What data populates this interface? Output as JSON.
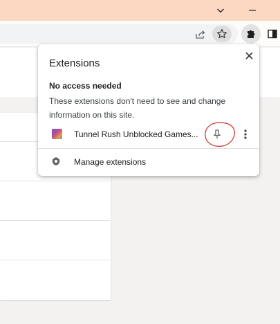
{
  "popup": {
    "title": "Extensions",
    "section_heading": "No access needed",
    "section_description": "These extensions don't need to see and change information on this site.",
    "extensions": [
      {
        "name": "Tunnel Rush Unblocked Games...",
        "pinned": false,
        "icon": "tunnel-rush-favicon"
      }
    ],
    "manage_label": "Manage extensions"
  },
  "icons": {
    "titlebar": [
      "chevron-down-icon",
      "minimize-icon"
    ],
    "toolbar": [
      "share-icon",
      "star-icon",
      "puzzle-icon",
      "side-panel-icon"
    ],
    "popup": [
      "close-icon",
      "pin-icon",
      "more-vert-icon",
      "gear-icon"
    ]
  },
  "colors": {
    "titlebar": "#fcd7c1",
    "annotation_circle": "#d12a2a",
    "page_background": "#f3f2f1"
  }
}
